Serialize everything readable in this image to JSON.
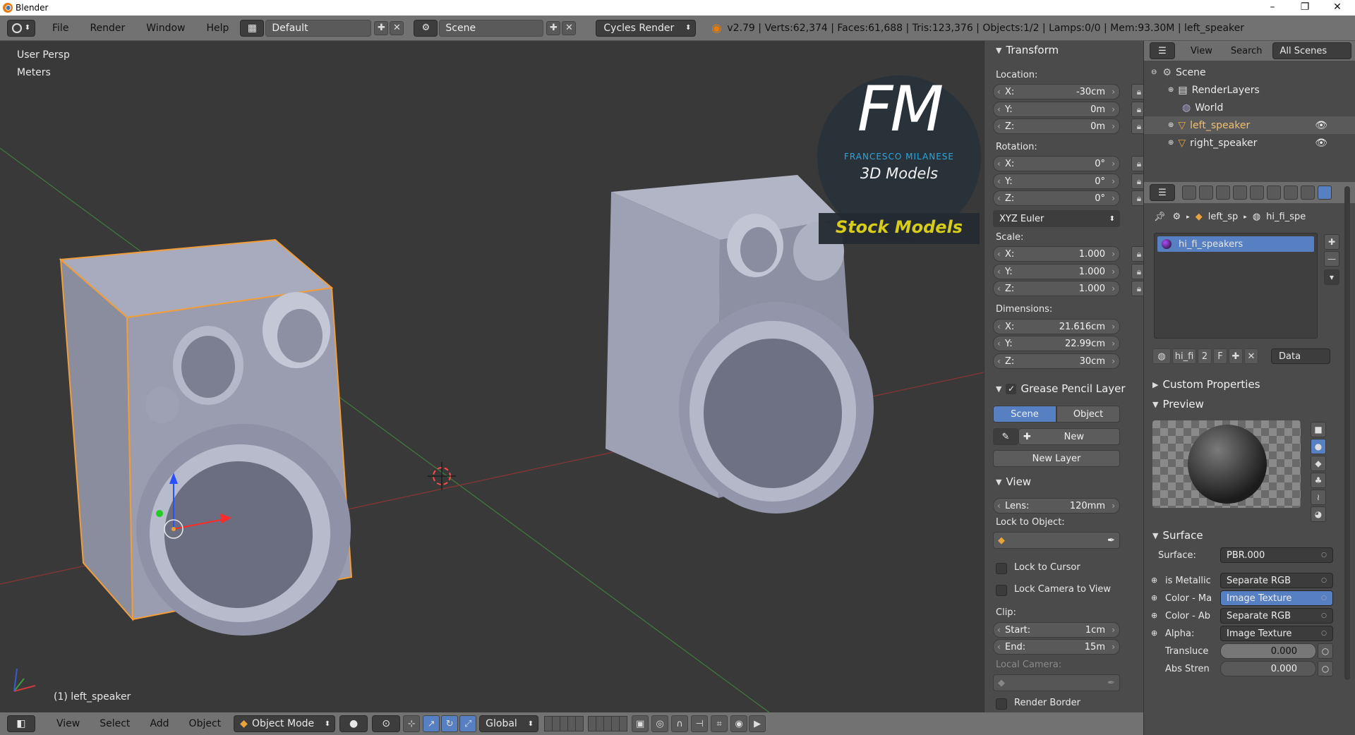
{
  "window": {
    "title": "Blender",
    "min": "–",
    "max": "❐",
    "close": "✕"
  },
  "topbar": {
    "menus": [
      "File",
      "Render",
      "Window",
      "Help"
    ],
    "screen_layout": "Default",
    "scene": "Scene",
    "engine": "Cycles Render",
    "stats": "v2.79 | Verts:62,374 | Faces:61,688 | Tris:123,376 | Objects:1/2 | Lamps:0/0 | Mem:93.30M | left_speaker"
  },
  "viewport": {
    "view_name": "User Persp",
    "units": "Meters",
    "active_object": "(1) left_speaker",
    "watermark": {
      "initials": "FM",
      "name": "FRANCESCO MILANESE",
      "subtitle": "3D Models",
      "badge": "Stock Models"
    }
  },
  "npanel": {
    "transform": {
      "title": "Transform",
      "location_label": "Location:",
      "location": [
        {
          "axis": "X:",
          "value": "-30cm"
        },
        {
          "axis": "Y:",
          "value": "0m"
        },
        {
          "axis": "Z:",
          "value": "0m"
        }
      ],
      "rotation_label": "Rotation:",
      "rotation": [
        {
          "axis": "X:",
          "value": "0°"
        },
        {
          "axis": "Y:",
          "value": "0°"
        },
        {
          "axis": "Z:",
          "value": "0°"
        }
      ],
      "rotation_mode": "XYZ Euler",
      "scale_label": "Scale:",
      "scale": [
        {
          "axis": "X:",
          "value": "1.000"
        },
        {
          "axis": "Y:",
          "value": "1.000"
        },
        {
          "axis": "Z:",
          "value": "1.000"
        }
      ],
      "dimensions_label": "Dimensions:",
      "dimensions": [
        {
          "axis": "X:",
          "value": "21.616cm"
        },
        {
          "axis": "Y:",
          "value": "22.99cm"
        },
        {
          "axis": "Z:",
          "value": "30cm"
        }
      ]
    },
    "grease_pencil": {
      "title": "Grease Pencil Layer",
      "tab_scene": "Scene",
      "tab_object": "Object",
      "new_label": "New",
      "new_layer_label": "New Layer"
    },
    "view": {
      "title": "View",
      "lens": "Lens:",
      "lens_value": "120mm",
      "lock_to_object": "Lock to Object:",
      "lock_to_cursor": "Lock to Cursor",
      "lock_camera": "Lock Camera to View",
      "clip": "Clip:",
      "clip_start_label": "Start:",
      "clip_start": "1cm",
      "clip_end_label": "End:",
      "clip_end": "15m",
      "local_camera": "Local Camera:",
      "render_border": "Render Border"
    }
  },
  "outliner": {
    "menu_view": "View",
    "menu_search": "Search",
    "scope": "All Scenes",
    "items": [
      "Scene",
      "RenderLayers",
      "World",
      "left_speaker",
      "right_speaker"
    ]
  },
  "properties": {
    "breadcrumb_object": "left_sp",
    "breadcrumb_material": "hi_fi_spe",
    "material_slot": "hi_fi_speakers",
    "datablock_name": "hi_fi",
    "users": "2",
    "fake": "F",
    "link": "Data",
    "custom_properties": "Custom Properties",
    "preview": "Preview",
    "surface_title": "Surface",
    "surface_label": "Surface:",
    "surface_value": "PBR.000",
    "inputs": [
      {
        "label": "is Metallic",
        "value": "Separate RGB"
      },
      {
        "label": "Color - Ma",
        "value": "Image Texture"
      },
      {
        "label": "Color - Ab",
        "value": "Separate RGB"
      },
      {
        "label": "Alpha:",
        "value": "Image Texture"
      }
    ],
    "translucency_label": "Transluce",
    "translucency": "0.000",
    "abs_strength_label": "Abs Stren",
    "abs_strength": "0.000"
  },
  "bottombar": {
    "menus": [
      "View",
      "Select",
      "Add",
      "Object"
    ],
    "mode": "Object Mode",
    "orientation": "Global"
  },
  "colors": {
    "accent": "#5680c2",
    "selection_outline": "#f19d3a",
    "watermark_blue": "#2aa7e0",
    "badge_yellow": "#d8cc1a"
  }
}
